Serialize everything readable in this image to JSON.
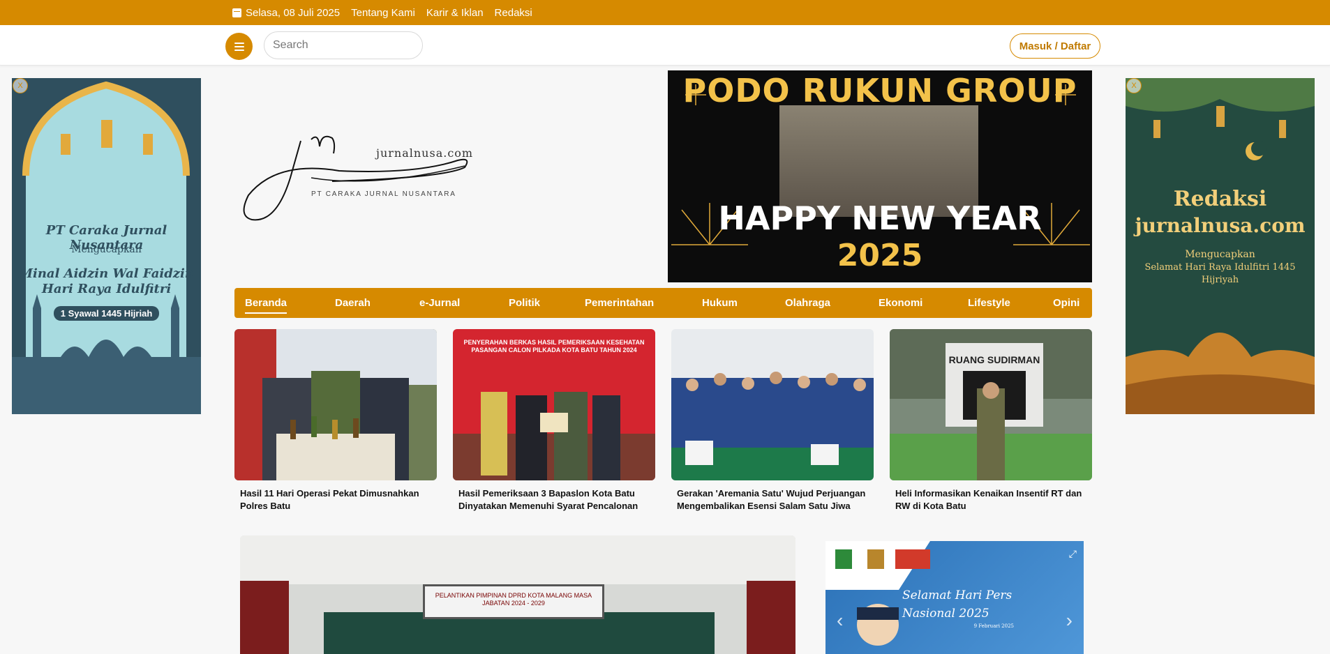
{
  "topbar": {
    "date": "Selasa, 08 Juli 2025",
    "links": [
      "Tentang Kami",
      "Karir & Iklan",
      "Redaksi"
    ]
  },
  "header": {
    "search_placeholder": "Search",
    "login_label": "Masuk / Daftar"
  },
  "logo": {
    "site": "jurnalnusa.com",
    "company": "PT CARAKA JURNAL NUSANTARA"
  },
  "left_ad": {
    "close": "X",
    "line1": "PT Caraka Jurnal Nusantara",
    "line2": "Mengucapkan",
    "line3": "Minal Aidzin Wal Faidzin",
    "line4": "Hari Raya Idulfitri",
    "line5": "1 Syawal 1445 Hijriah"
  },
  "right_ad": {
    "close": "X",
    "line1": "Redaksi",
    "line2": "jurnalnusa.com",
    "line3": "Mengucapkan",
    "line4": "Selamat Hari Raya Idulfitri 1445",
    "line5": "Hijriyah"
  },
  "banner": {
    "line1": "PODO RUKUN GROUP",
    "line2": "HAPPY NEW YEAR",
    "line3": "2025"
  },
  "nav": {
    "items": [
      "Beranda",
      "Daerah",
      "e-Jurnal",
      "Politik",
      "Pemerintahan",
      "Hukum",
      "Olahraga",
      "Ekonomi",
      "Lifestyle",
      "Opini"
    ],
    "active": "Beranda"
  },
  "cards": [
    {
      "title": "Hasil 11 Hari Operasi Pekat Dimusnahkan Polres Batu"
    },
    {
      "title": "Hasil Pemeriksaan 3 Bapaslon Kota Batu Dinyatakan Memenuhi Syarat Pencalonan",
      "photo_text": "PENYERAHAN BERKAS HASIL PEMERIKSAAN KESEHATAN PASANGAN CALON PILKADA KOTA BATU TAHUN 2024"
    },
    {
      "title": "Gerakan 'Aremania Satu' Wujud Perjuangan Mengembalikan Esensi Salam Satu Jiwa"
    },
    {
      "title": "Heli Informasikan Kenaikan Insentif RT dan RW di Kota Batu",
      "photo_text": "RUANG SUDIRMAN"
    }
  ],
  "feature": {
    "screen_text": "PELANTIKAN PIMPINAN DPRD KOTA MALANG MASA JABATAN 2024 - 2029"
  },
  "slider": {
    "caption": "Selamat Hari Pers Nasional 2025",
    "date": "9 Februari 2025"
  },
  "colors": {
    "accent": "#d68a00",
    "topbar_text": "#ffffff"
  }
}
